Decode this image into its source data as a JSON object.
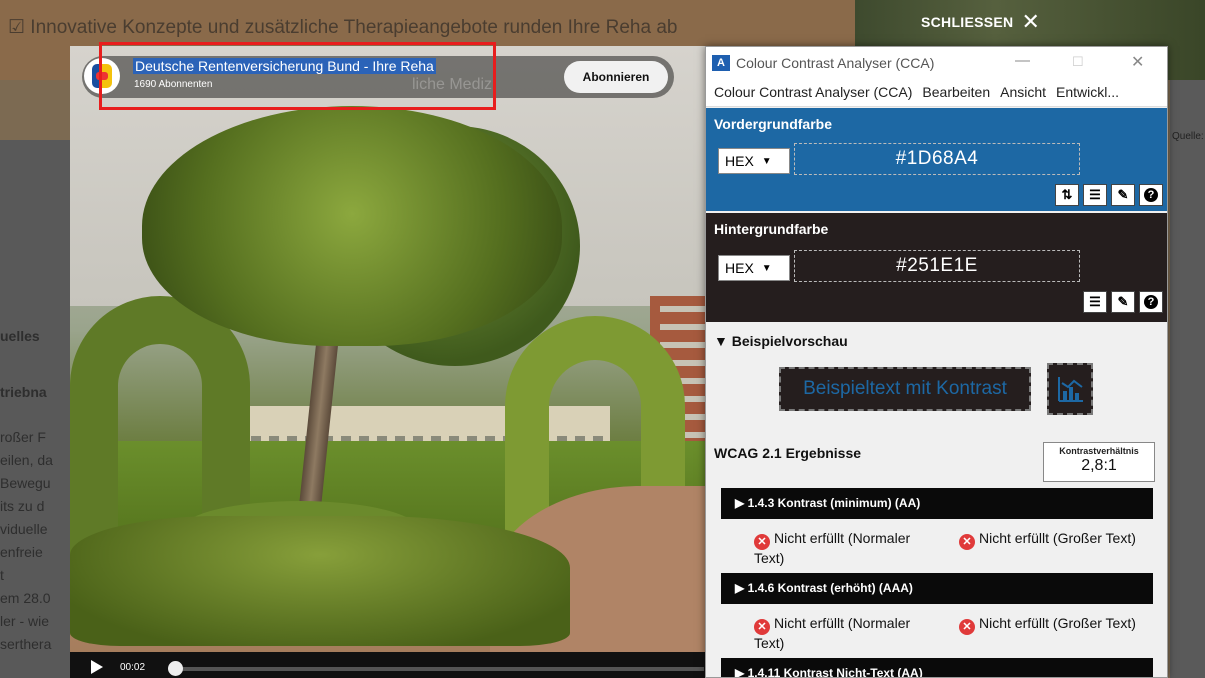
{
  "background_page": {
    "banner_text": "☑  Innovative Konzepte und zusätzliche Therapieangebote runden Ihre Reha ab",
    "left_lines": [
      "uelles",
      "triebna",
      "roßer F",
      "eilen, da",
      "Bewegu",
      "its zu d",
      "viduelle",
      "enfreie",
      "t",
      "em 28.0",
      "ler - wie",
      "serthera"
    ],
    "quelle": "Quelle:"
  },
  "overlay": {
    "close_label": "SCHLIESSEN",
    "close_icon": "✕"
  },
  "video": {
    "channel_name": "Deutsche Rentenversicherung Bund - Ihre Reha",
    "subscribers": "1690 Abonnenten",
    "ghost_title": "liche Mediz",
    "subscribe_label": "Abonnieren",
    "time": "00:02",
    "progress": 0.0
  },
  "cca": {
    "app_icon": "A",
    "title": "Colour Contrast Analyser (CCA)",
    "window_buttons": {
      "min": "—",
      "max": "☐",
      "close": "✕"
    },
    "menu": [
      "Colour Contrast Analyser (CCA)",
      "Bearbeiten",
      "Ansicht",
      "Entwickl..."
    ],
    "foreground": {
      "title": "Vordergrundfarbe",
      "format": "HEX",
      "value": "#1D68A4",
      "color": "#1d68a4",
      "tools": [
        "⇅",
        "☰",
        "✎",
        "?"
      ]
    },
    "background": {
      "title": "Hintergrundfarbe",
      "format": "HEX",
      "value": "#251E1E",
      "color": "#251e1e",
      "tools": [
        "☰",
        "✎",
        "?"
      ]
    },
    "preview": {
      "title": "▼ Beispielvorschau",
      "sample_text": "Beispieltext mit Kontrast"
    },
    "wcag": {
      "title": "WCAG 2.1 Ergebnisse",
      "ratio_label": "Kontrastverhältnis",
      "ratio_value": "2,8:1",
      "criteria": [
        {
          "label": "▶  1.4.3 Kontrast (minimum) (AA)",
          "normal": "Nicht erfüllt (Normaler Text)",
          "large": "Nicht erfüllt (Großer Text)"
        },
        {
          "label": "▶  1.4.6 Kontrast (erhöht) (AAA)",
          "normal": "Nicht erfüllt (Normaler Text)",
          "large": "Nicht erfüllt (Großer Text)"
        },
        {
          "label": "▶  1.4.11 Kontrast Nicht-Text (AA)"
        }
      ],
      "fail_icon": "✕"
    }
  }
}
